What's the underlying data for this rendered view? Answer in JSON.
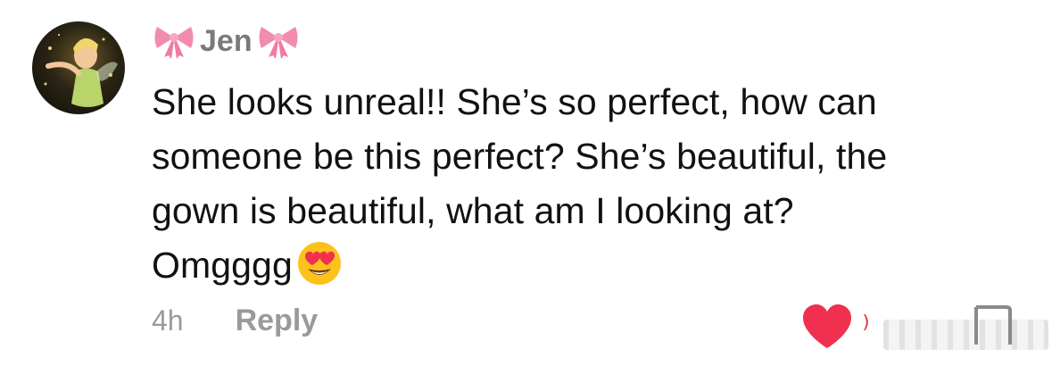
{
  "comment": {
    "username": "Jen",
    "lines": [
      "She looks unreal!! She’s so perfect, how can",
      "someone be this perfect? She’s beautiful, the",
      "gown is beautiful, what am I looking at?",
      "Omgggg"
    ],
    "emoji": "heart-eyes-emoji",
    "time": "4h",
    "reply_label": "Reply"
  },
  "colors": {
    "like": "#f0304e",
    "meta_text": "#9a9a9a",
    "bow": "#f28bb0"
  }
}
